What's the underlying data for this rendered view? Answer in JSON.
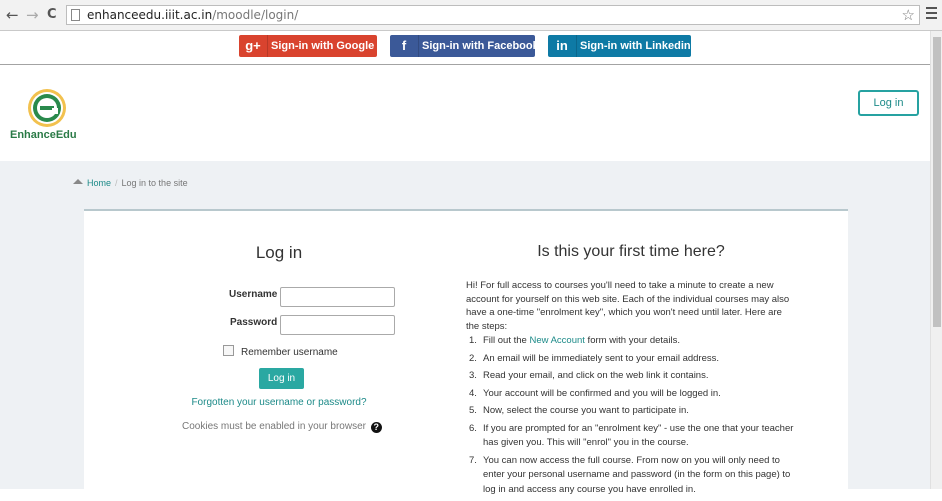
{
  "browser": {
    "url_host": "enhanceedu.iiit.ac.in",
    "url_path": "/moodle/login/",
    "back_glyph": "←",
    "forward_glyph": "→",
    "reload_glyph": "C",
    "star_glyph": "☆"
  },
  "social": {
    "google": {
      "icon": "g+",
      "label": "Sign-in with Google",
      "color": "#d9432e"
    },
    "facebook": {
      "icon": "f",
      "label": "Sign-in with Facebook",
      "color": "#3b5998"
    },
    "linkedin": {
      "icon": "in",
      "label": "Sign-in with Linkedin",
      "color": "#0e7aa5"
    }
  },
  "header": {
    "logo_text": "EnhanceEdu",
    "login_button": "Log in"
  },
  "breadcrumb": {
    "home": "Home",
    "separator": "/",
    "current": "Log in to the site"
  },
  "login_form": {
    "title": "Log in",
    "username_label": "Username",
    "password_label": "Password",
    "username_value": "",
    "password_value": "",
    "remember_label": "Remember username",
    "submit_label": "Log in",
    "forgot_link": "Forgotten your username or password?",
    "cookies_note": "Cookies must be enabled in your browser"
  },
  "first_time": {
    "title": "Is this your first time here?",
    "intro": "Hi! For full access to courses you'll need to take a minute to create a new account for yourself on this web site. Each of the individual courses may also have a one-time \"enrolment key\", which you won't need until later. Here are the steps:",
    "step1_pre": "Fill out the ",
    "step1_link": "New Account",
    "step1_post": " form with your details.",
    "steps": [
      "An email will be immediately sent to your email address.",
      "Read your email, and click on the web link it contains.",
      "Your account will be confirmed and you will be logged in.",
      "Now, select the course you want to participate in.",
      "If you are prompted for an \"enrolment key\" - use the one that your teacher has given you. This will \"enrol\" you in the course.",
      "You can now access the full course. From now on you will only need to enter your personal username and password (in the form on this page) to log in and access any course you have enrolled in."
    ],
    "numbers": [
      "1.",
      "2.",
      "3.",
      "4.",
      "5.",
      "6.",
      "7."
    ]
  },
  "colors": {
    "accent": "#26a2a1",
    "background_grey": "#eef1f4"
  }
}
